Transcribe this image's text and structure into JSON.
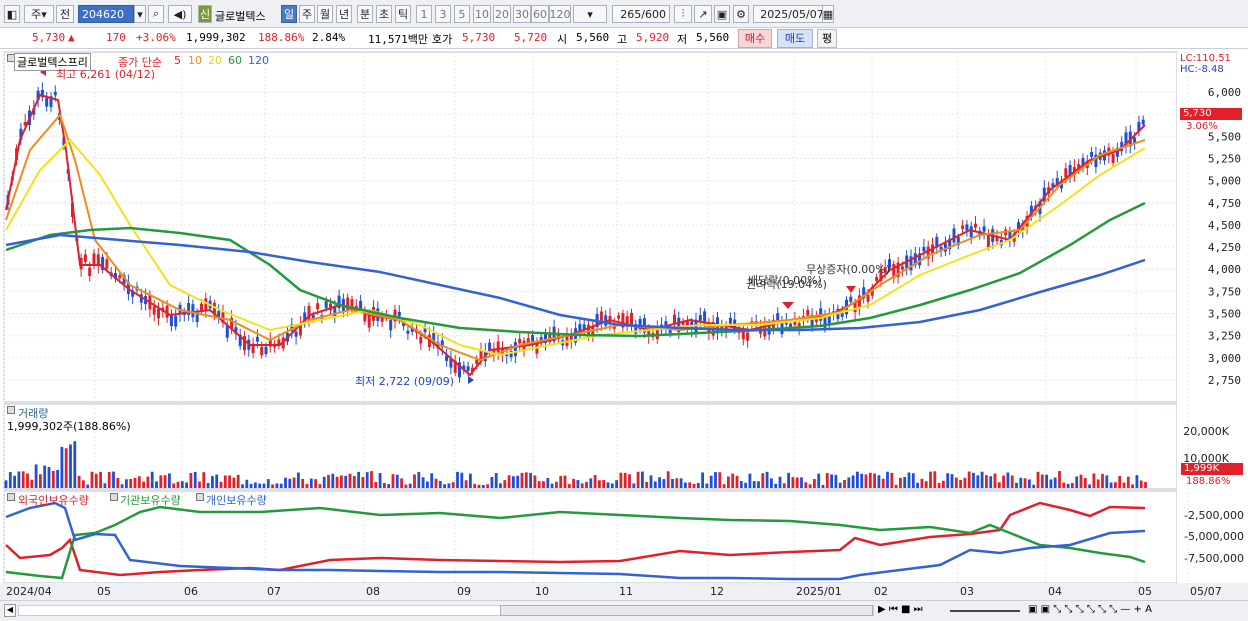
{
  "toolbar": {
    "type_label": "주",
    "prev_label": "전",
    "code": "204620",
    "stock_name": "글로벌텍스",
    "shin": "신",
    "periods": [
      "일",
      "주",
      "월",
      "년",
      "분",
      "초",
      "틱"
    ],
    "numbers": [
      "1",
      "3",
      "5",
      "10",
      "20",
      "30",
      "60",
      "120"
    ],
    "count": "265",
    "count_max": "/600",
    "date": "2025/05/07"
  },
  "info": {
    "price": "5,730",
    "arrow": "▲",
    "change": "170",
    "change_pct": "+3.06%",
    "volume": "1,999,302",
    "volume_pct": "188.86%",
    "turnover": "2.84%",
    "amount": "11,571백만",
    "hoga_label": "호가",
    "ask": "5,730",
    "bid": "5,720",
    "open_label": "시",
    "open": "5,560",
    "high_label": "고",
    "high": "5,920",
    "low_label": "저",
    "low": "5,560",
    "buy": "매수",
    "sell": "매도",
    "eval": "평"
  },
  "price_panel": {
    "title": "글로벌텍스프리",
    "ma_label": "종가 단순",
    "ma_periods": [
      "5",
      "10",
      "20",
      "60",
      "120"
    ],
    "ma_colors": [
      "#e0202a",
      "#f08c1a",
      "#f2e21a",
      "#239a3c",
      "#3361d8"
    ],
    "lc": "LC:110.51",
    "hc": "HC:-8.48",
    "y_ticks": [
      "6,000",
      "5,750",
      "5,500",
      "5,250",
      "5,000",
      "4,750",
      "4,500",
      "4,250",
      "4,000",
      "3,750",
      "3,500",
      "3,250",
      "3,000",
      "2,750"
    ],
    "current_price": "5,730",
    "current_pct": "3.06%",
    "high_note": "최고 6,261 (04/12)",
    "low_note": "최저 2,722 (09/09)",
    "event1": "무상증자(0.00%)",
    "event2": "배당락(0.00%)",
    "event3": "권리락(19.04%)"
  },
  "volume_panel": {
    "title": "거래량",
    "value": "1,999,302주(188.86%)",
    "y_ticks": [
      "20,000K",
      "10,000K"
    ],
    "current": "1,999K",
    "current_pct": "188.86%"
  },
  "holdings_panel": {
    "series": [
      "외국인보유수량",
      "기관보유수량",
      "개인보유수량"
    ],
    "colors": [
      "#e0202a",
      "#239a3c",
      "#3361d8"
    ],
    "y_ticks": [
      "-2,500,000",
      "-5,000,000",
      "-7,500,000"
    ]
  },
  "x_axis": [
    "2024/04",
    "05",
    "06",
    "07",
    "08",
    "09",
    "10",
    "11",
    "12",
    "2025/01",
    "02",
    "03",
    "04",
    "05",
    "05/07"
  ]
}
